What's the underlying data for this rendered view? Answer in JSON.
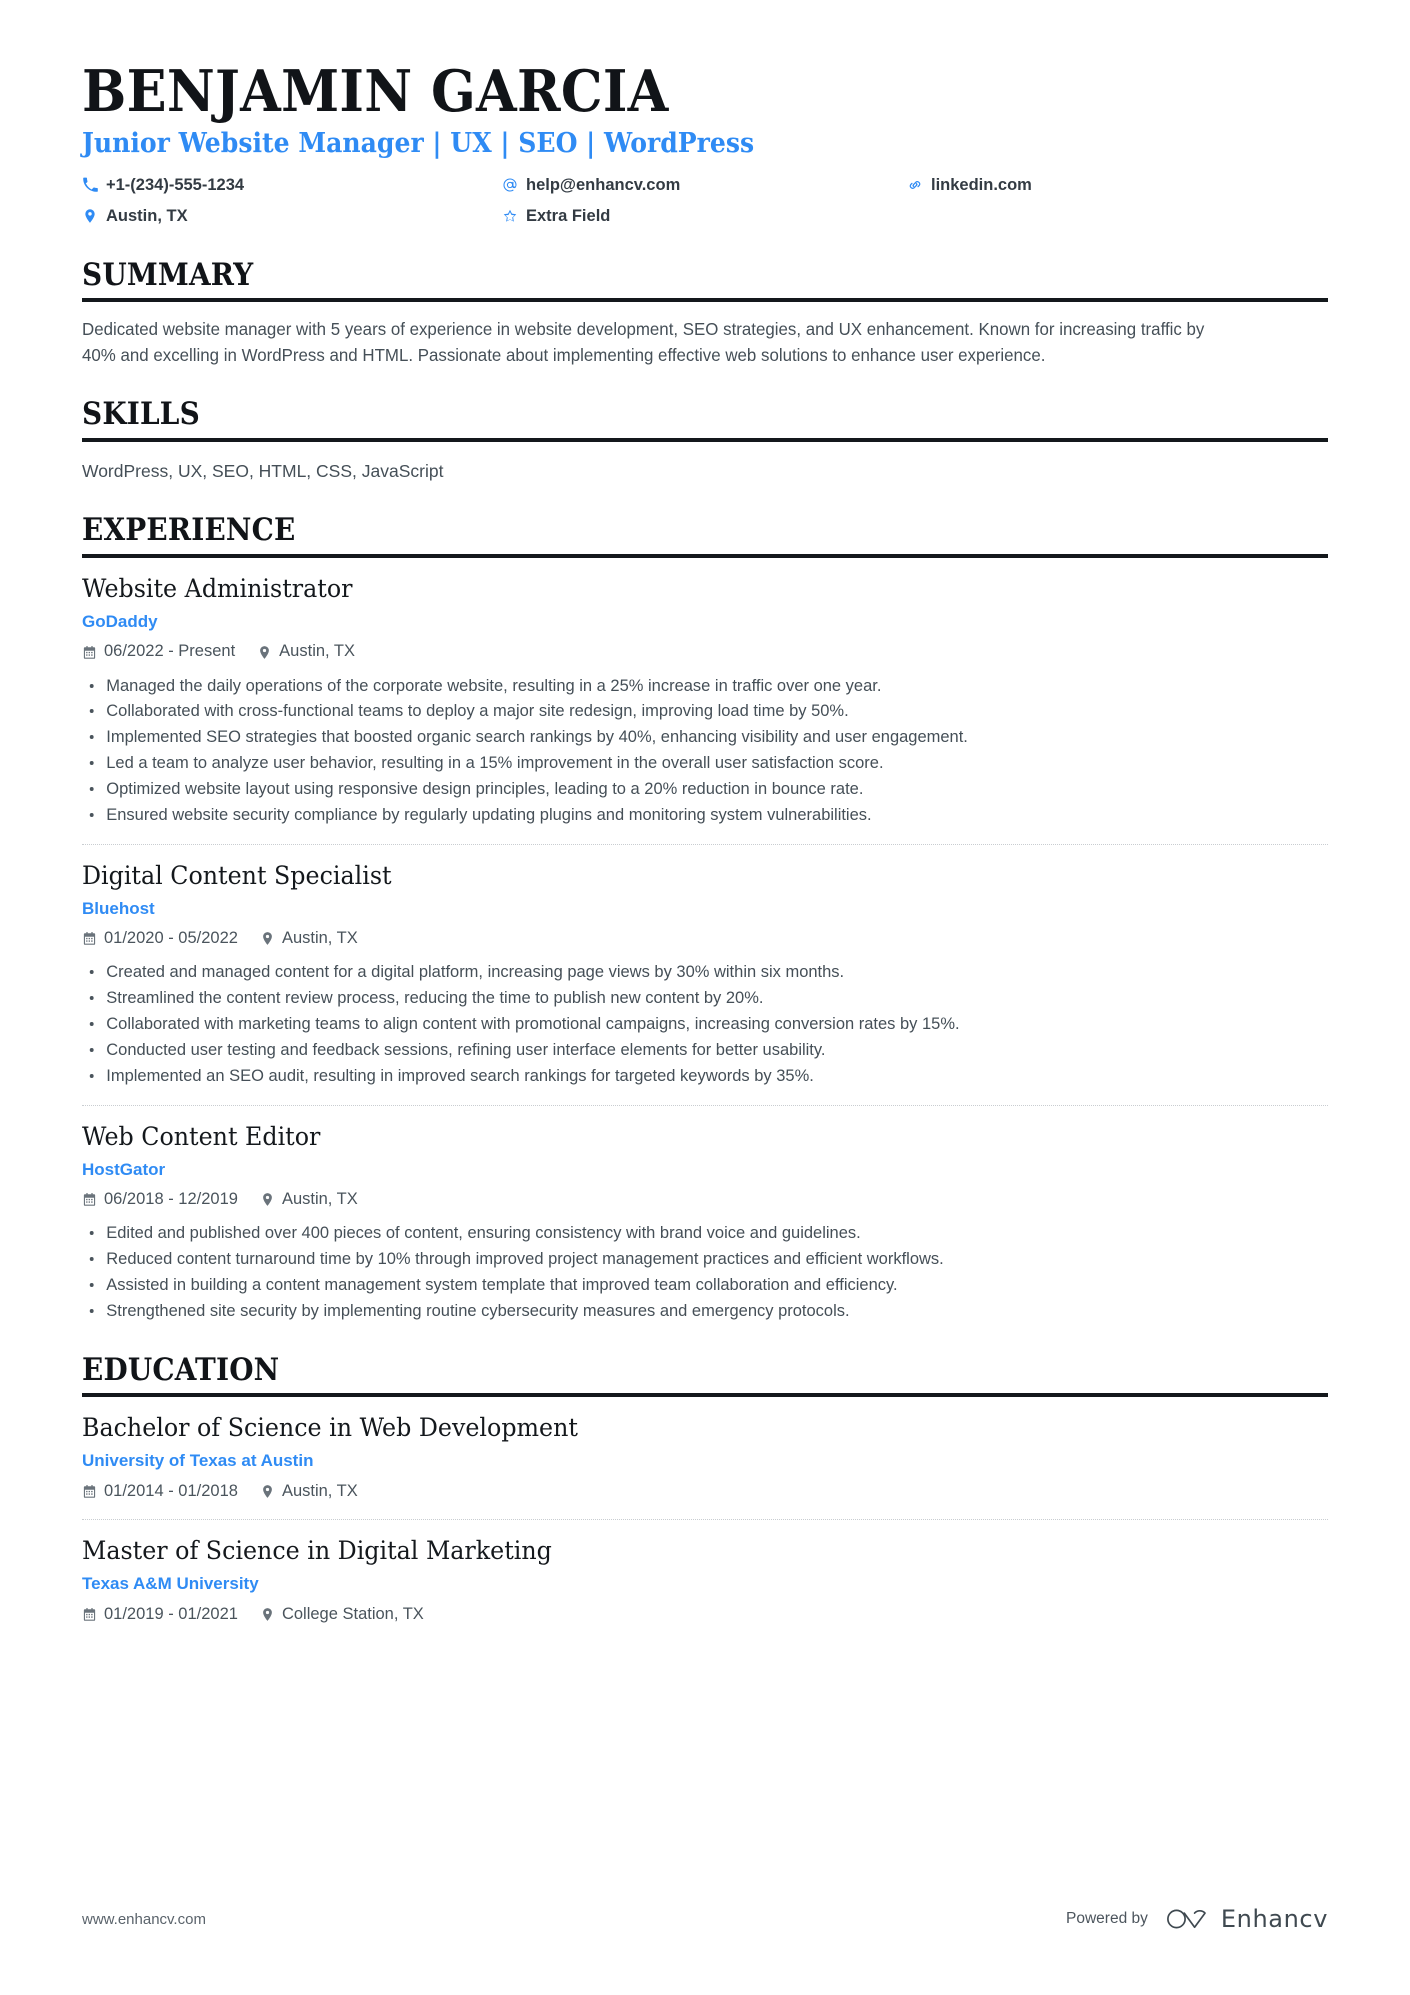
{
  "header": {
    "name": "BENJAMIN GARCIA",
    "headline": "Junior Website Manager | UX | SEO | WordPress",
    "contacts": [
      {
        "icon": "phone-icon",
        "text": "+1-(234)-555-1234"
      },
      {
        "icon": "email-icon",
        "text": "help@enhancv.com"
      },
      {
        "icon": "link-icon",
        "text": "linkedin.com"
      },
      {
        "icon": "location-icon",
        "text": "Austin, TX"
      },
      {
        "icon": "star-icon",
        "text": "Extra Field"
      }
    ]
  },
  "accent_color": "#2f8bf4",
  "sections": {
    "summary": {
      "title": "SUMMARY",
      "text": "Dedicated website manager with 5 years of experience in website development, SEO strategies, and UX enhancement. Known for increasing traffic by 40% and excelling in WordPress and HTML. Passionate about implementing effective web solutions to enhance user experience."
    },
    "skills": {
      "title": "SKILLS",
      "text": "WordPress, UX, SEO, HTML, CSS, JavaScript"
    },
    "experience": {
      "title": "EXPERIENCE",
      "entries": [
        {
          "title": "Website Administrator",
          "org": "GoDaddy",
          "dates": "06/2022 - Present",
          "location": "Austin, TX",
          "bullets": [
            "Managed the daily operations of the corporate website, resulting in a 25% increase in traffic over one year.",
            "Collaborated with cross-functional teams to deploy a major site redesign, improving load time by 50%.",
            "Implemented SEO strategies that boosted organic search rankings by 40%, enhancing visibility and user engagement.",
            "Led a team to analyze user behavior, resulting in a 15% improvement in the overall user satisfaction score.",
            "Optimized website layout using responsive design principles, leading to a 20% reduction in bounce rate.",
            "Ensured website security compliance by regularly updating plugins and monitoring system vulnerabilities."
          ]
        },
        {
          "title": "Digital Content Specialist",
          "org": "Bluehost",
          "dates": "01/2020 - 05/2022",
          "location": "Austin, TX",
          "bullets": [
            "Created and managed content for a digital platform, increasing page views by 30% within six months.",
            "Streamlined the content review process, reducing the time to publish new content by 20%.",
            "Collaborated with marketing teams to align content with promotional campaigns, increasing conversion rates by 15%.",
            "Conducted user testing and feedback sessions, refining user interface elements for better usability.",
            "Implemented an SEO audit, resulting in improved search rankings for targeted keywords by 35%."
          ]
        },
        {
          "title": "Web Content Editor",
          "org": "HostGator",
          "dates": "06/2018 - 12/2019",
          "location": "Austin, TX",
          "bullets": [
            "Edited and published over 400 pieces of content, ensuring consistency with brand voice and guidelines.",
            "Reduced content turnaround time by 10% through improved project management practices and efficient workflows.",
            "Assisted in building a content management system template that improved team collaboration and efficiency.",
            "Strengthened site security by implementing routine cybersecurity measures and emergency protocols."
          ]
        }
      ]
    },
    "education": {
      "title": "EDUCATION",
      "entries": [
        {
          "title": "Bachelor of Science in Web Development",
          "org": "University of Texas at Austin",
          "dates": "01/2014 - 01/2018",
          "location": "Austin, TX",
          "bullets": []
        },
        {
          "title": "Master of Science in Digital Marketing",
          "org": "Texas A&M University",
          "dates": "01/2019 - 01/2021",
          "location": "College Station, TX",
          "bullets": []
        }
      ]
    }
  },
  "footer": {
    "url": "www.enhancv.com",
    "powered_by": "Powered by",
    "brand": "Enhancv"
  }
}
